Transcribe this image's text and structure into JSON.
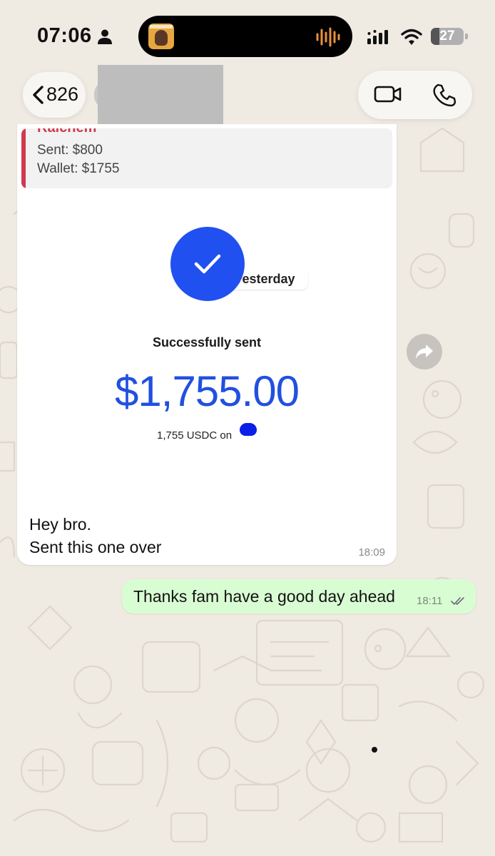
{
  "status_bar": {
    "time": "07:06",
    "battery": "27",
    "battery_percent": 27
  },
  "header": {
    "back_count": "826",
    "icons": [
      "chevron-left-icon",
      "video-camera-icon",
      "phone-icon"
    ]
  },
  "messages": [
    {
      "direction": "incoming",
      "quote": {
        "author": "Ralchem",
        "line1": "Sent: $800",
        "line2": "Wallet: $1755"
      },
      "date_chip": "Yesterday",
      "receipt": {
        "status": "Successfully sent",
        "amount": "$1,755.00",
        "subtitle": "1,755 USDC on"
      },
      "text_line1": "Hey bro.",
      "text_line2": "Sent this one over",
      "time": "18:09"
    },
    {
      "direction": "outgoing",
      "text": "Thanks fam have a good day ahead",
      "time": "18:11",
      "read": true
    }
  ],
  "colors": {
    "wallpaper": "#efeae2",
    "outgoing_bubble": "#d9fdd3",
    "accent_blue": "#2150e0",
    "quote_red": "#d03a4e"
  }
}
